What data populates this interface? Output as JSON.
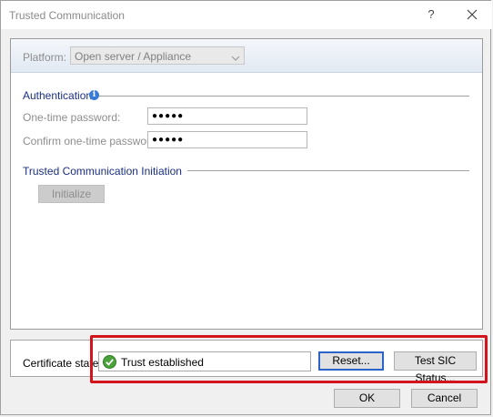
{
  "window": {
    "title": "Trusted Communication",
    "help_glyph": "?",
    "close_label": "Close"
  },
  "platform": {
    "label": "Platform:",
    "selected": "Open server / Appliance"
  },
  "authentication": {
    "title": "Authentication",
    "info_glyph": "i",
    "otp_label": "One-time password:",
    "otp_value": "●●●●●",
    "confirm_label": "Confirm one-time password:",
    "confirm_value": "●●●●●"
  },
  "initiation": {
    "title": "Trusted Communication Initiation",
    "initialize_label": "Initialize"
  },
  "certificate": {
    "label": "Certificate state:",
    "status": "Trust established",
    "reset_label": "Reset...",
    "test_label": "Test SIC Status..."
  },
  "footer": {
    "ok_label": "OK",
    "cancel_label": "Cancel"
  },
  "colors": {
    "section_title": "#1a2f83",
    "highlight": "#d4141d",
    "check": "#4aa23a"
  }
}
